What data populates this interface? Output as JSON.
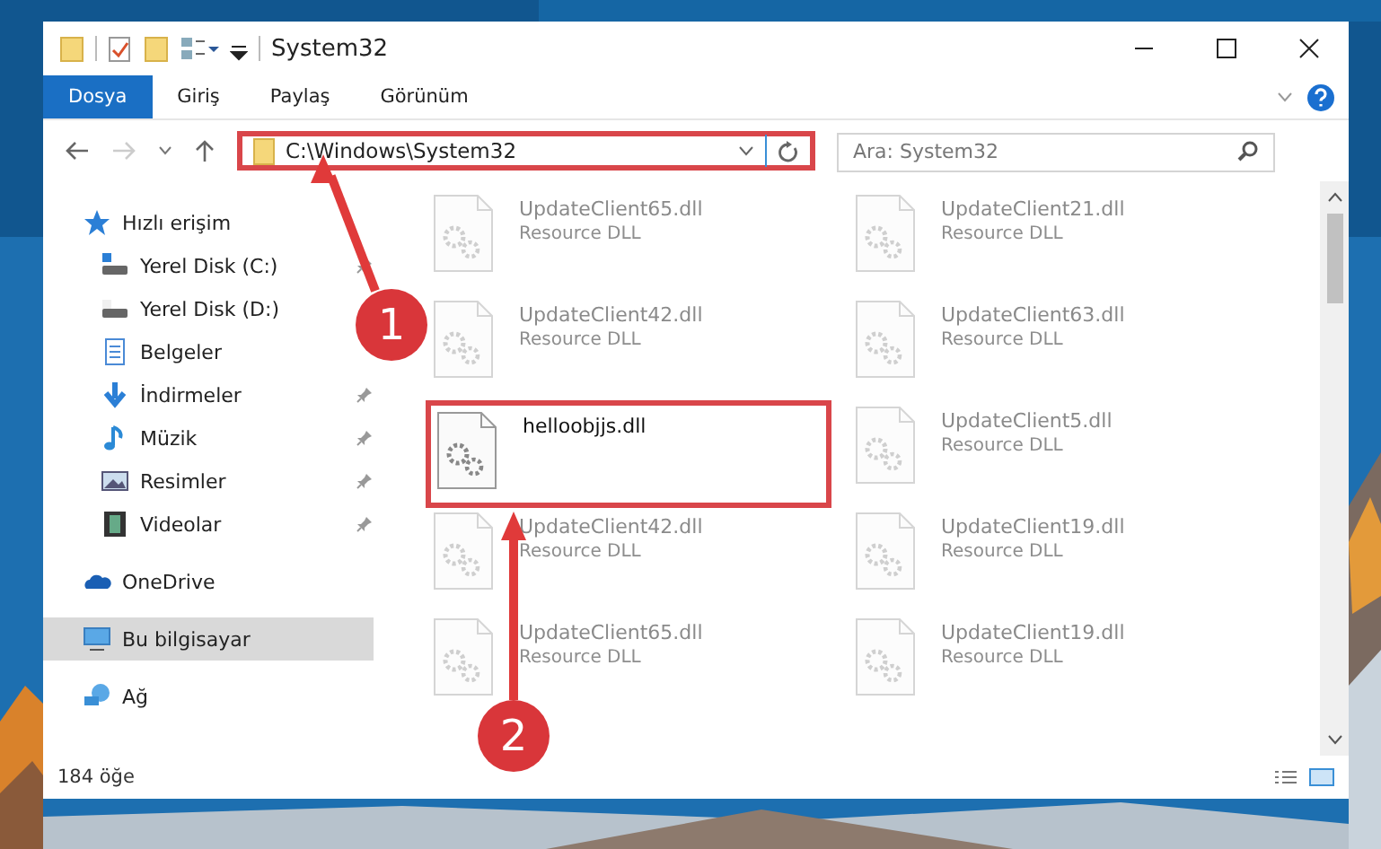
{
  "window": {
    "title": "System32"
  },
  "ribbon_tabs": [
    {
      "label": "Dosya",
      "selected": true
    },
    {
      "label": "Giriş",
      "selected": false
    },
    {
      "label": "Paylaş",
      "selected": false
    },
    {
      "label": "Görünüm",
      "selected": false
    }
  ],
  "address_bar": {
    "value": "C:\\Windows\\System32",
    "highlighted": true
  },
  "search": {
    "placeholder": "Ara: System32"
  },
  "sidebar": {
    "items": [
      {
        "label": "Hızlı erişim",
        "selected": false,
        "children": [
          {
            "label": "Yerel Disk (C:)",
            "pinned": true,
            "selected": false
          },
          {
            "label": "Yerel Disk (D:)",
            "pinned": false,
            "selected": false
          },
          {
            "label": "Belgeler",
            "pinned": false,
            "selected": false
          },
          {
            "label": "İndirmeler",
            "pinned": true,
            "selected": false
          },
          {
            "label": "Müzik",
            "pinned": true,
            "selected": false
          },
          {
            "label": "Resimler",
            "pinned": true,
            "selected": false
          },
          {
            "label": "Videolar",
            "pinned": true,
            "selected": false
          }
        ]
      },
      {
        "label": "OneDrive",
        "selected": false
      },
      {
        "label": "Bu bilgisayar",
        "selected": true
      },
      {
        "label": "Ağ",
        "selected": false
      }
    ]
  },
  "files": [
    {
      "name": "UpdateClient65.dll",
      "type": "Resource DLL",
      "highlighted": false
    },
    {
      "name": "UpdateClient21.dll",
      "type": "Resource DLL",
      "highlighted": false
    },
    {
      "name": "UpdateClient42.dll",
      "type": "Resource DLL",
      "highlighted": false
    },
    {
      "name": "UpdateClient63.dll",
      "type": "Resource DLL",
      "highlighted": false
    },
    {
      "name": "helloobjjs.dll",
      "highlighted": true
    },
    {
      "name": "UpdateClient5.dll",
      "type": "Resource DLL",
      "highlighted": false
    },
    {
      "name": "UpdateClient42.dll",
      "type": "Resource DLL",
      "highlighted": false
    },
    {
      "name": "UpdateClient19.dll",
      "type": "Resource DLL",
      "highlighted": false
    },
    {
      "name": "UpdateClient65.dll",
      "type": "Resource DLL",
      "highlighted": false
    },
    {
      "name": "UpdateClient19.dll",
      "type": "Resource DLL",
      "highlighted": false
    }
  ],
  "status_bar": {
    "count": "184 öğe"
  },
  "annotations": [
    {
      "number": "1"
    },
    {
      "number": "2"
    }
  ]
}
